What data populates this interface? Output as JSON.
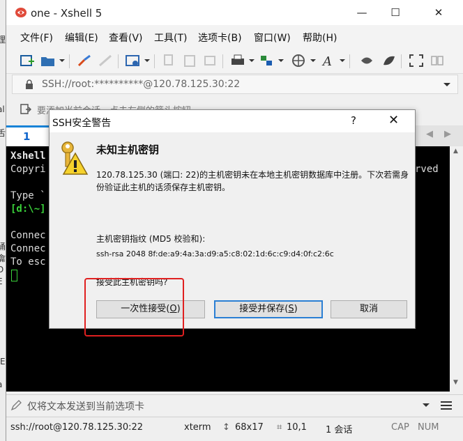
{
  "window": {
    "title": "one - Xshell 5",
    "controls": {
      "minimize": "—",
      "maximize": "☐",
      "close": "✕"
    }
  },
  "left_strip_glyphs": [
    "理",
    "al",
    "舌",
    "诵",
    "龠",
    "D",
    "E",
    "\\E",
    "a"
  ],
  "menu": [
    "文件(F)",
    "编辑(E)",
    "查看(V)",
    "工具(T)",
    "选项卡(B)",
    "窗口(W)",
    "帮助(H)"
  ],
  "address": {
    "value": "SSH://root:**********@120.78.125.30:22"
  },
  "hint": {
    "text": "要添加当前会话，点击左侧的箭头按钮。"
  },
  "tab": {
    "label": "1 one"
  },
  "terminal": {
    "lines": [
      {
        "text": "Xshell",
        "color": "#e8e8e8",
        "bold": true
      },
      {
        "text": "Copyri",
        "color": "#dddddd",
        "bold": false
      },
      {
        "text": "",
        "color": "#dddddd",
        "bold": false
      },
      {
        "text": "Type `",
        "color": "#dddddd",
        "bold": false
      },
      {
        "text": "[d:\\~]",
        "color": "#3ad13a",
        "bold": true
      },
      {
        "text": "",
        "color": "#dddddd",
        "bold": false
      },
      {
        "text": "Connec",
        "color": "#dddddd",
        "bold": false
      },
      {
        "text": "Connec",
        "color": "#dddddd",
        "bold": false
      },
      {
        "text": "To esc",
        "color": "#dddddd",
        "bold": false
      }
    ],
    "right_fragment": "rved"
  },
  "send_bar": {
    "text": "仅将文本发送到当前选项卡"
  },
  "status": {
    "connection": "ssh://root@120.78.125.30:22",
    "terminal_type": "xterm",
    "size": "68x17",
    "cursor": "10,1",
    "sessions": "1 会话",
    "caps": "CAP",
    "num": "NUM"
  },
  "dialog": {
    "title": "SSH安全警告",
    "help": "?",
    "close": "✕",
    "heading": "未知主机密钥",
    "message": "120.78.125.30 (端口: 22)的主机密钥未在本地主机密钥数据库中注册。下次若需身份验证此主机的话须保存主机密钥。",
    "fingerprint_label": "主机密钥指纹 (MD5 校验和):",
    "fingerprint": "ssh-rsa 2048 8f:de:a9:4a:3a:d9:a5:c8:02:1d:6c:c9:d4:0f:c2:6c",
    "question": "接受此主机密钥吗?",
    "buttons": {
      "accept_once": {
        "label": "一次性接受(",
        "key": "O",
        "tail": ")"
      },
      "accept_save": {
        "label": "接受并保存(",
        "key": "S",
        "tail": ")"
      },
      "cancel": {
        "label": "取消"
      }
    }
  },
  "colors": {
    "accent_blue": "#1883d7",
    "highlight_red": "#e02020",
    "terminal_green": "#3ad13a"
  },
  "icons": [
    "app-logo-icon",
    "new-session-icon",
    "open-folder-icon",
    "disconnect-icon",
    "properties-icon",
    "copy-icon",
    "paste-icon",
    "print-icon",
    "transfer-icon",
    "globe-icon",
    "font-icon",
    "xftp-icon",
    "xmanager-icon",
    "fullscreen-icon",
    "lock-icon",
    "key-warning-icon",
    "menu-icon"
  ]
}
